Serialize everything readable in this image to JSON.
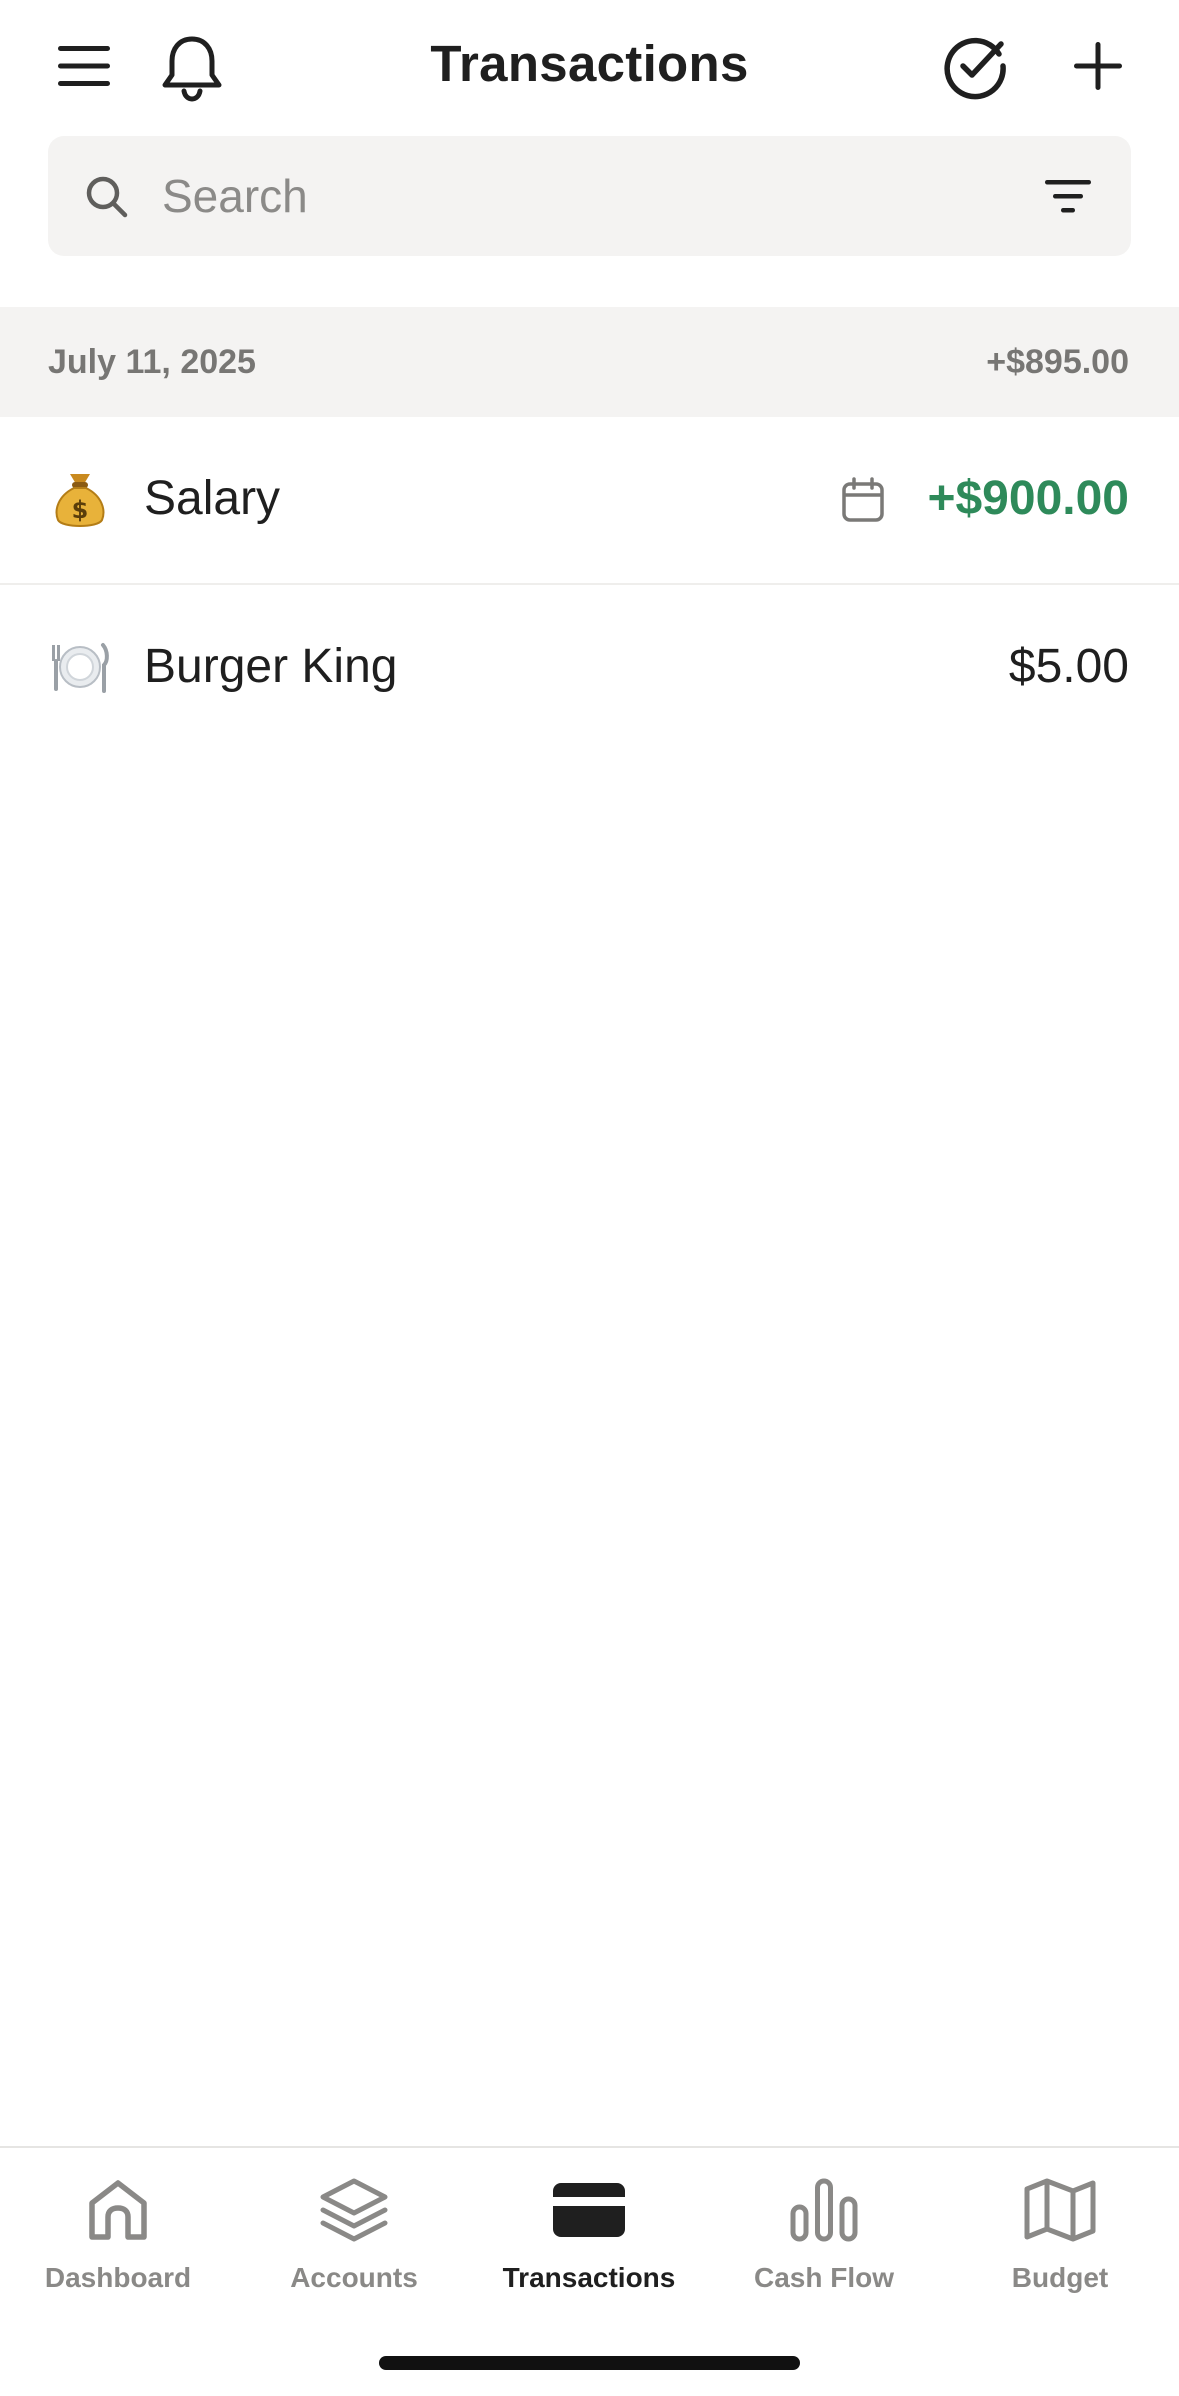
{
  "header": {
    "title": "Transactions",
    "menu_icon": "hamburger-menu-icon",
    "bell_icon": "bell-icon",
    "check_icon": "check-circle-icon",
    "add_icon": "plus-icon"
  },
  "search": {
    "placeholder": "Search",
    "value": "",
    "icon": "search-icon",
    "filter_icon": "filter-icon"
  },
  "groups": [
    {
      "date": "July 11, 2025",
      "total": "+$895.00",
      "transactions": [
        {
          "emoji": "💰",
          "name": "Salary",
          "amount": "+$900.00",
          "scheduled_icon": "calendar-icon",
          "positive": true
        },
        {
          "emoji": "🍽️",
          "name": "Burger King",
          "amount": "$5.00",
          "positive": false
        }
      ]
    }
  ],
  "bottom_nav": {
    "items": [
      {
        "label": "Dashboard",
        "icon": "home-icon",
        "active": false
      },
      {
        "label": "Accounts",
        "icon": "layers-icon",
        "active": false
      },
      {
        "label": "Transactions",
        "icon": "credit-card-icon",
        "active": true
      },
      {
        "label": "Cash Flow",
        "icon": "bar-chart-icon",
        "active": false
      },
      {
        "label": "Budget",
        "icon": "map-icon",
        "active": false
      }
    ]
  },
  "colors": {
    "positive": "#2e8a5a",
    "muted": "#777674",
    "search_bg": "#f4f3f2",
    "active_nav": "#1f1f1f",
    "inactive_nav": "#8a8987"
  }
}
